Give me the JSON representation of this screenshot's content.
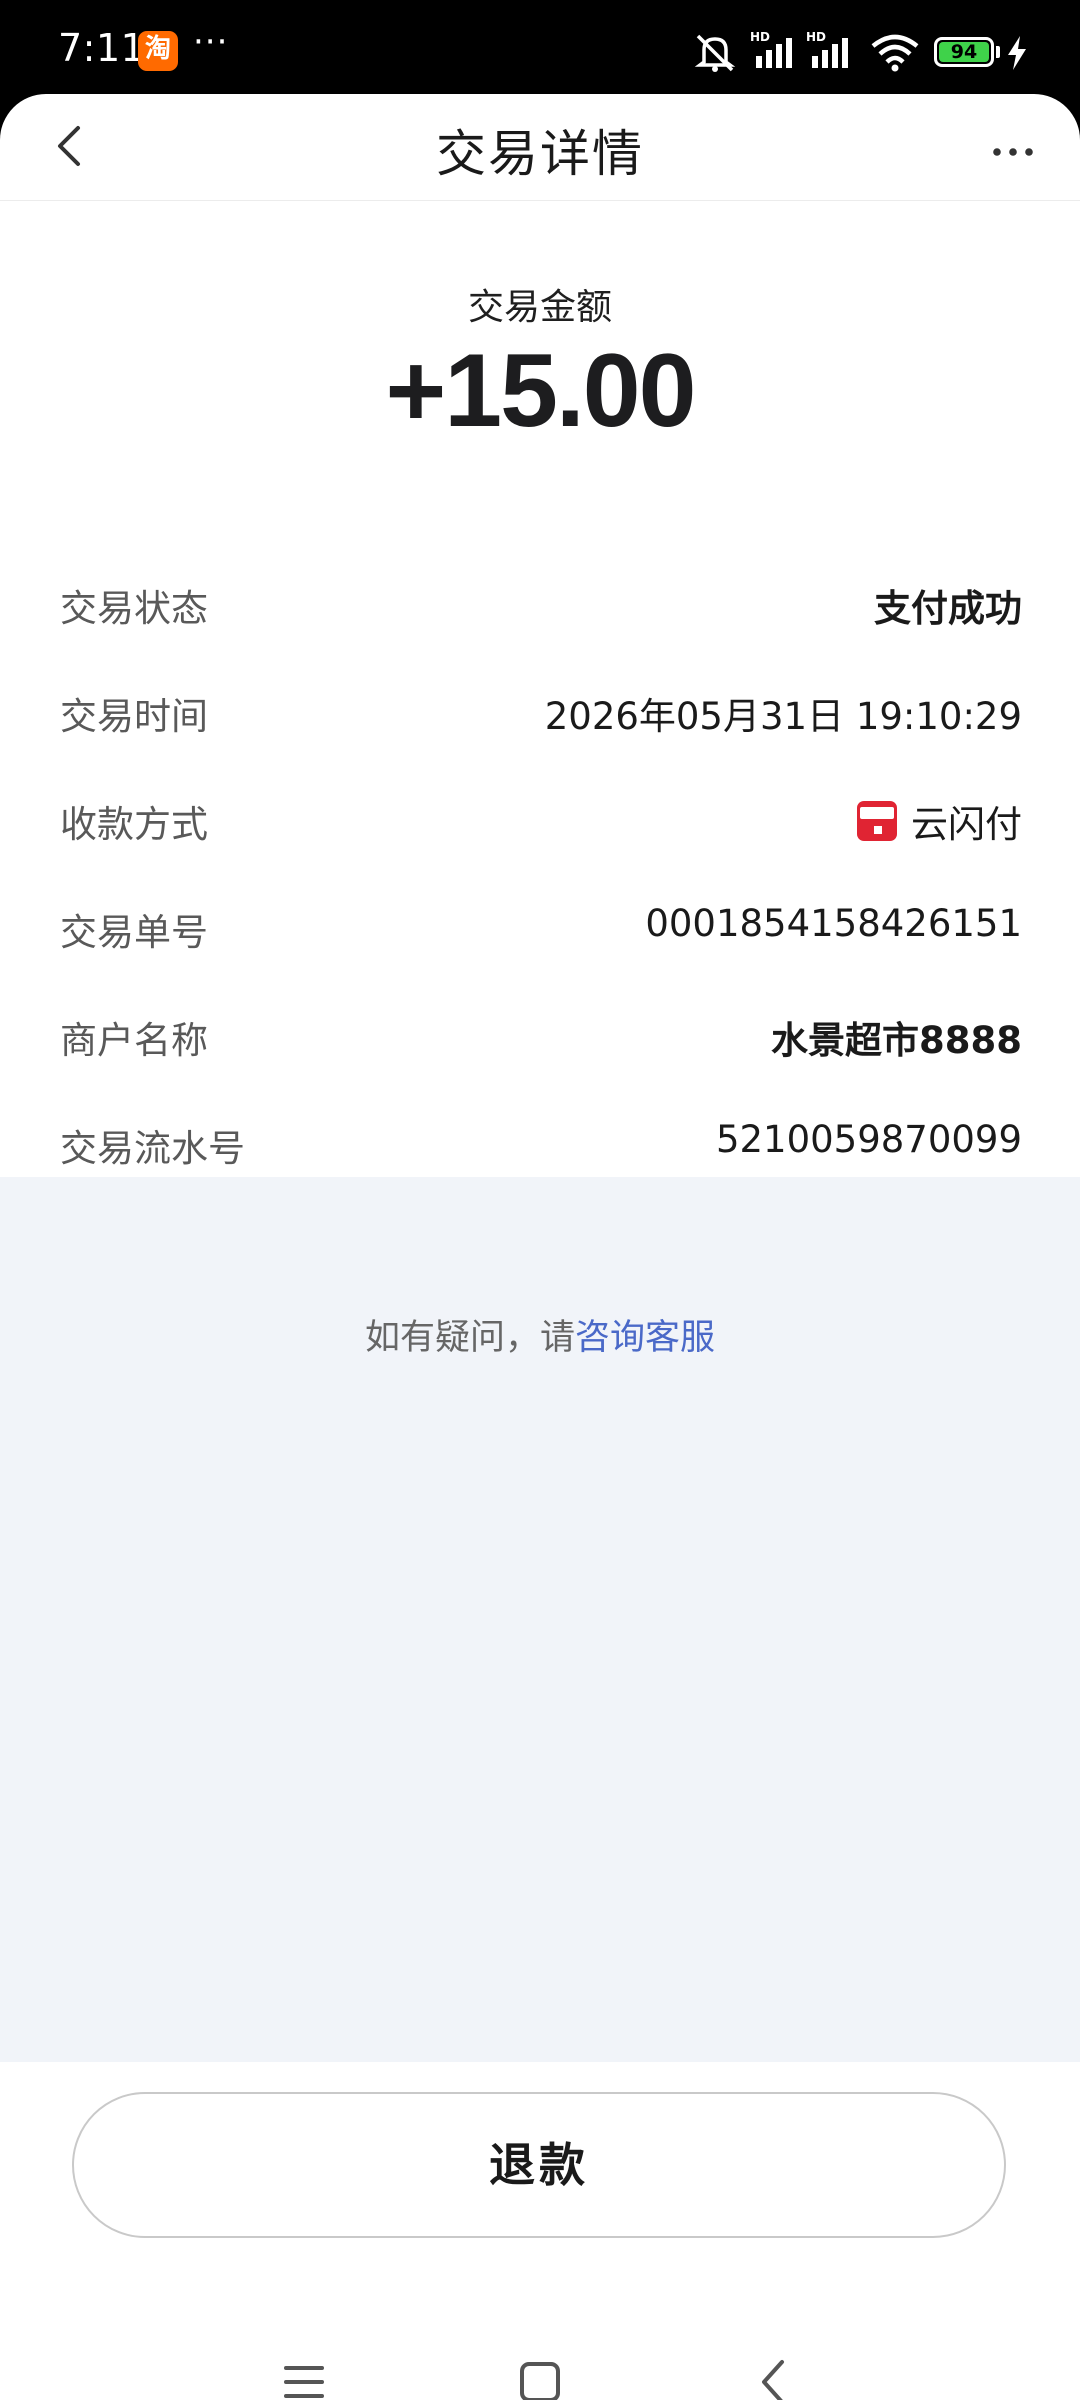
{
  "status_bar": {
    "time": "7:11",
    "app_icon_char": "淘",
    "overflow": "···",
    "battery": "94",
    "icons": [
      "bell-muted-icon",
      "hd-signal-icon",
      "hd-signal-icon",
      "wifi-icon",
      "battery-icon",
      "charging-icon"
    ]
  },
  "header": {
    "title": "交易详情",
    "back_icon": "chevron-left-icon",
    "more_icon": "more-horizontal-icon"
  },
  "amount": {
    "label": "交易金额",
    "value": "+15.00"
  },
  "details": {
    "rows": [
      {
        "label": "交易状态",
        "value": "支付成功"
      },
      {
        "label": "交易时间",
        "value": "2026年05月31日 19:10:29"
      },
      {
        "label": "收款方式",
        "value": "云闪付",
        "icon": "unionpay-icon"
      },
      {
        "label": "交易单号",
        "value": "0001854158426151"
      },
      {
        "label": "商户名称",
        "value": "水景超市8888"
      },
      {
        "label": "交易流水号",
        "value": "5210059870099"
      }
    ]
  },
  "help": {
    "prefix": "如有疑问，请",
    "link": "咨询客服"
  },
  "refund_button": "退款",
  "system_nav": [
    "menu-icon",
    "home-icon",
    "back-icon"
  ],
  "colors": {
    "link": "#4a69c8",
    "grey_background": "#f1f4f9",
    "battery_fill": "#3fd24a"
  }
}
